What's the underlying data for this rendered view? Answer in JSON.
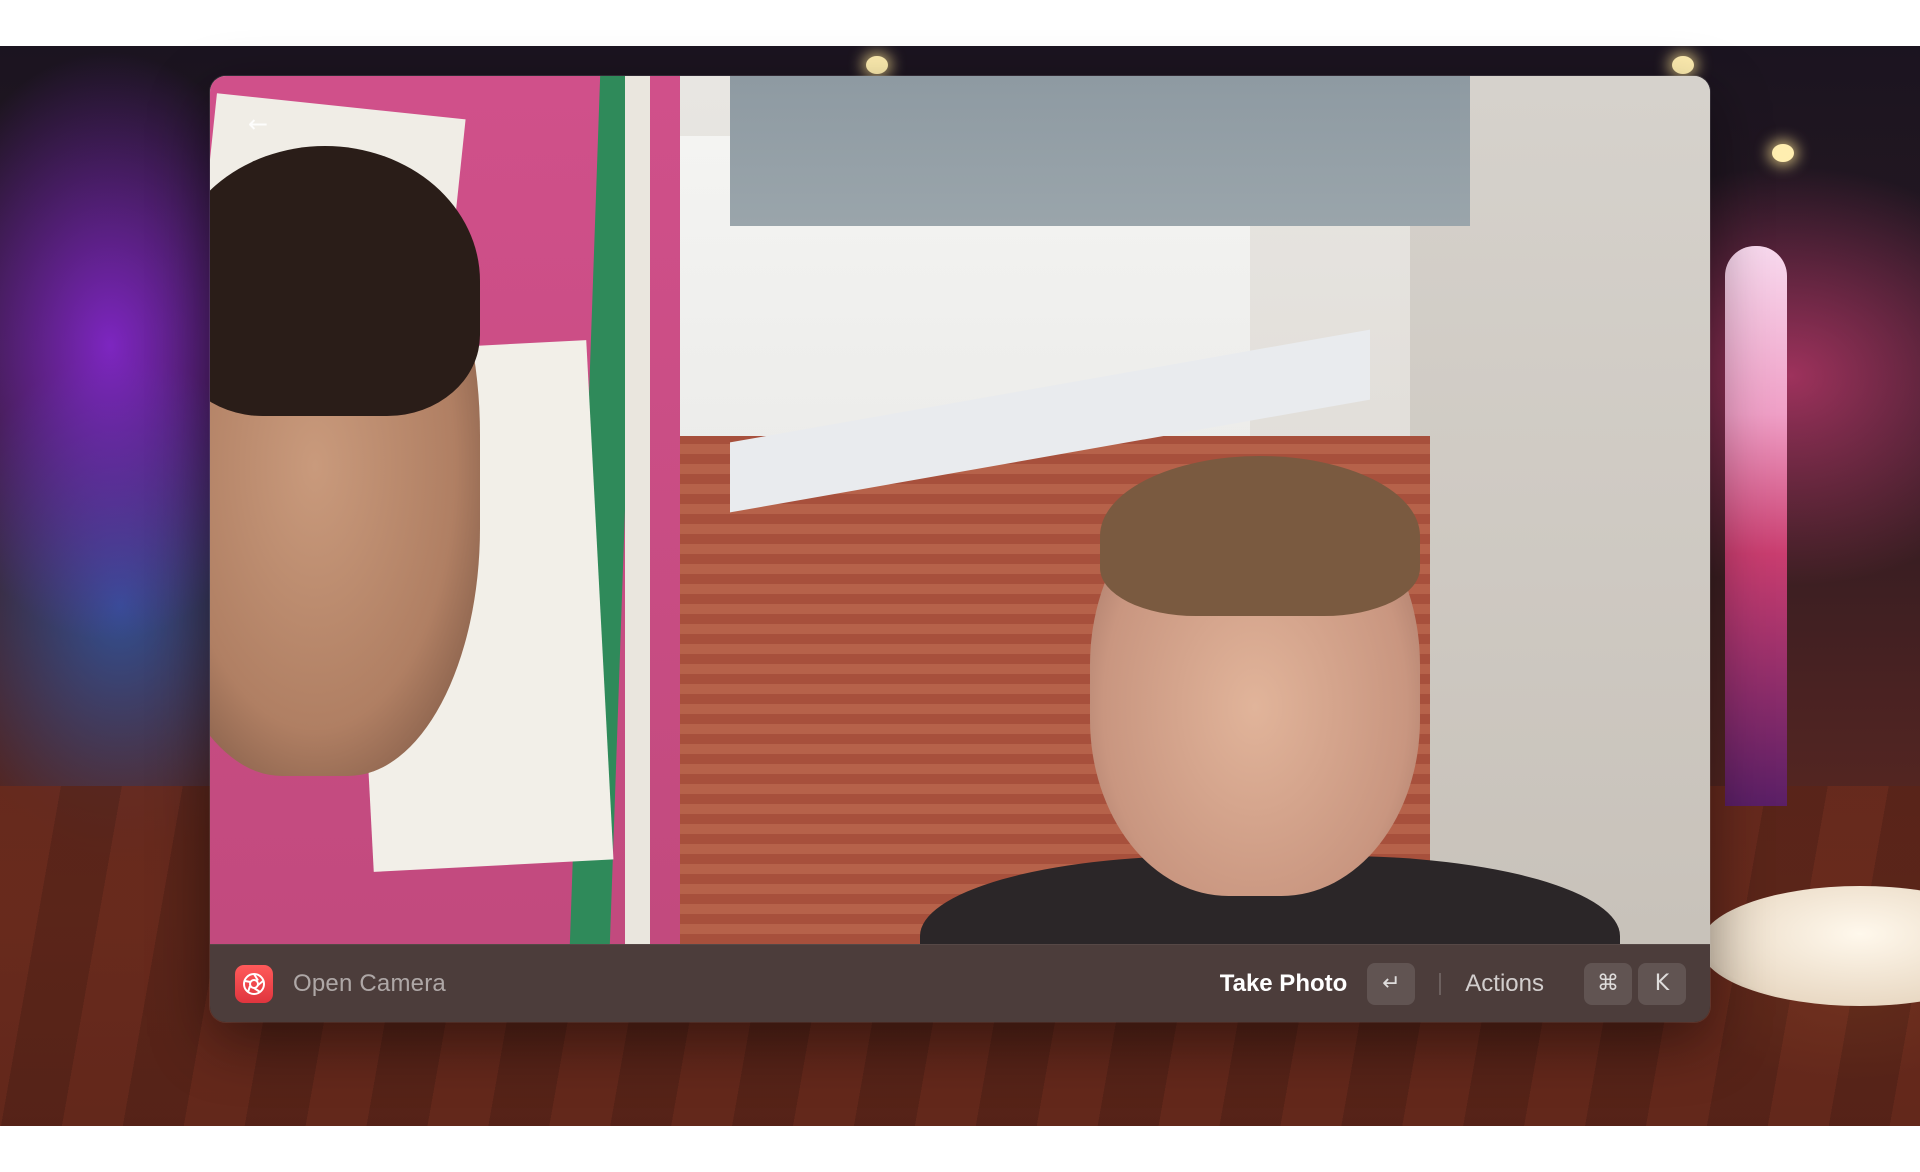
{
  "window": {
    "back_symbol": "←"
  },
  "action_bar": {
    "app_icon": "camera-aperture-icon",
    "app_icon_color": "#e8404a",
    "title": "Open Camera",
    "primary_action": {
      "label": "Take Photo",
      "shortcut": "↵"
    },
    "actions": {
      "label": "Actions",
      "shortcut_modifier": "⌘",
      "shortcut_key": "K"
    }
  }
}
